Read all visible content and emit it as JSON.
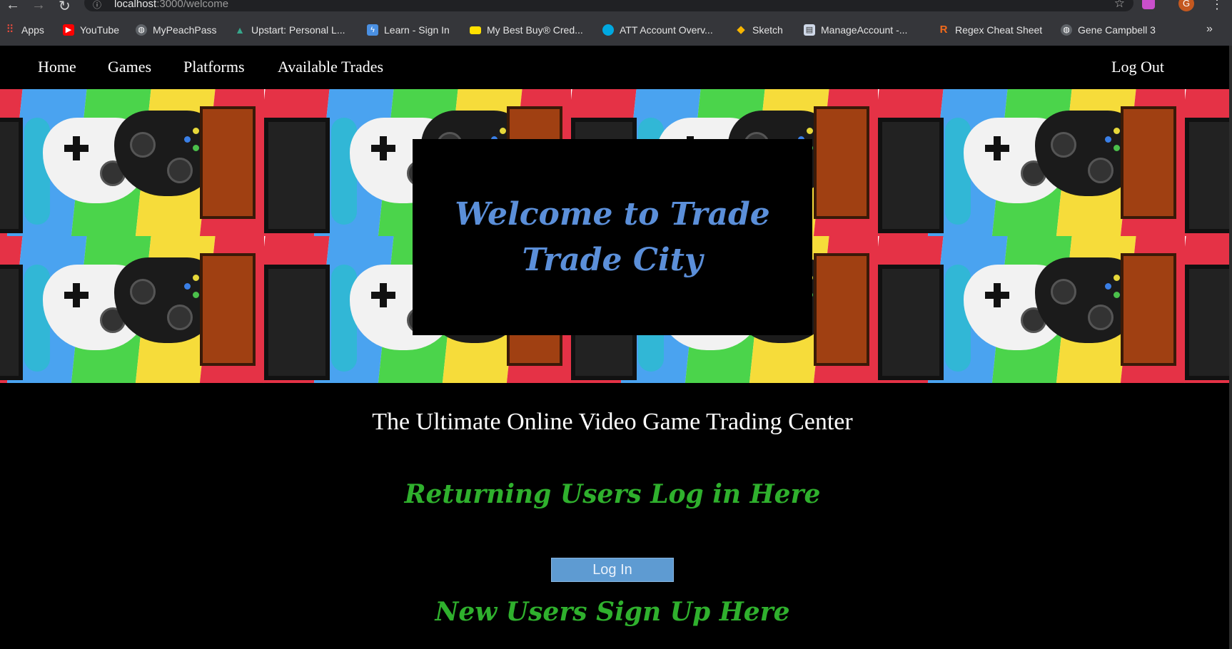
{
  "browser": {
    "url_host": "localhost",
    "url_path": ":3000/welcome",
    "avatar_letter": "G",
    "bookmarks": [
      {
        "label": "Apps",
        "icon": "apps-grid-icon",
        "color": "#e94b3c"
      },
      {
        "label": "YouTube",
        "icon": "youtube-icon",
        "color": "#ff0000"
      },
      {
        "label": "MyPeachPass",
        "icon": "globe-icon",
        "color": "#9aa0a6"
      },
      {
        "label": "Upstart: Personal L...",
        "icon": "upstart-icon",
        "color": "#37a78c"
      },
      {
        "label": "Learn - Sign In",
        "icon": "learn-icon",
        "color": "#4a90e2"
      },
      {
        "label": "My Best Buy® Cred...",
        "icon": "bestbuy-card-icon",
        "color": "#ffe000"
      },
      {
        "label": "ATT Account Overv...",
        "icon": "att-icon",
        "color": "#00a8e0"
      },
      {
        "label": "Sketch",
        "icon": "sketch-diamond-icon",
        "color": "#f7b500"
      },
      {
        "label": "ManageAccount -...",
        "icon": "document-icon",
        "color": "#cfd8e8"
      },
      {
        "label": "Regex Cheat Sheet",
        "icon": "regex-r-icon",
        "color": "#f26a1b"
      },
      {
        "label": "Gene Campbell 3",
        "icon": "globe-icon",
        "color": "#9aa0a6"
      }
    ],
    "bookmarks_overflow": "»"
  },
  "nav": {
    "home": "Home",
    "games": "Games",
    "platforms": "Platforms",
    "trades": "Available Trades",
    "logout": "Log Out"
  },
  "hero": {
    "title": "Welcome to Trade Trade City",
    "colors": {
      "title": "#5b8fd9",
      "box": "#000000"
    }
  },
  "main": {
    "tagline": "The Ultimate Online Video Game Trading Center",
    "returning_heading": "Returning Users Log in Here",
    "login_button": "Log In",
    "new_users_heading": "New Users Sign Up Here",
    "colors": {
      "heading": "#2fb02d",
      "button": "#5e9bd2"
    }
  }
}
